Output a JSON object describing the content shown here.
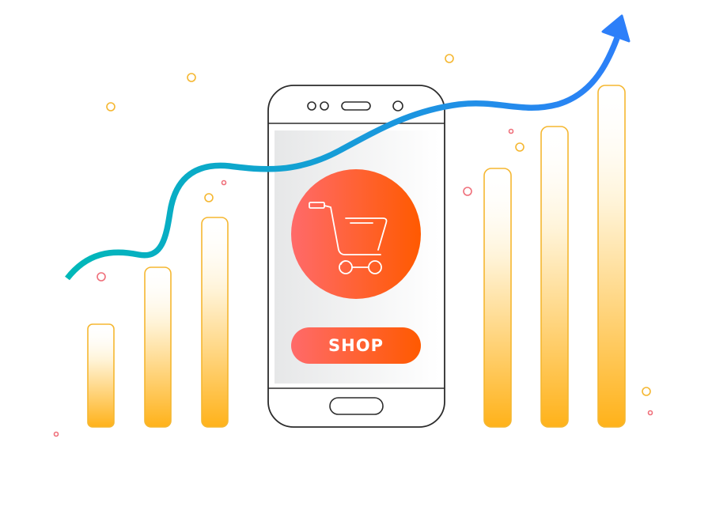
{
  "illustration": {
    "shop_button_label": "SHOP",
    "icons": {
      "cart": "shopping-cart-icon",
      "trend": "growth-arrow-icon",
      "device": "smartphone"
    },
    "colors": {
      "bar_stroke": "#f5b731",
      "bar_fill_bottom": "#ffb21a",
      "arrow_start": "#00b8b8",
      "arrow_end": "#2d7ff9",
      "cart_circle_start": "#ff6a6a",
      "cart_circle_end": "#ff5a00",
      "phone_outline": "#2b2b2b",
      "screen_start": "#e6e6e6",
      "screen_end": "#ffffff",
      "dot_yellow": "#f5b731",
      "dot_red": "#ef6f7a"
    }
  }
}
